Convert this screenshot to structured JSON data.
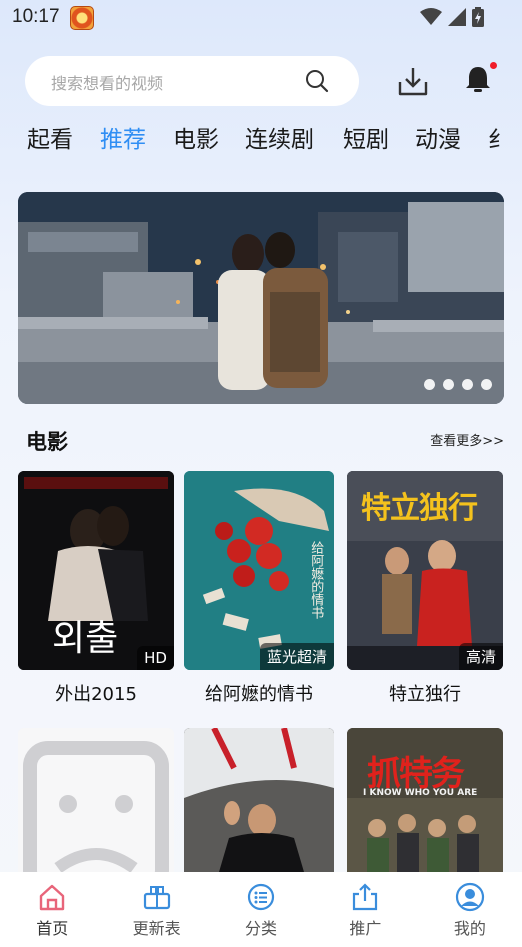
{
  "status_bar": {
    "time": "10:17"
  },
  "search": {
    "placeholder": "搜索想看的视频"
  },
  "tabs": [
    {
      "label": "起看"
    },
    {
      "label": "推荐",
      "active": true
    },
    {
      "label": "电影"
    },
    {
      "label": "连续剧"
    },
    {
      "label": "短剧"
    },
    {
      "label": "动漫"
    },
    {
      "label": "纟"
    }
  ],
  "banner": {
    "slide_count": 4
  },
  "section": {
    "title": "电影",
    "more": "查看更多>>"
  },
  "movies": [
    {
      "title": "外出2015",
      "badge": "HD",
      "poster_text": "외출"
    },
    {
      "title": "给阿嬷的情书",
      "badge": "蓝光超清",
      "poster_text": "给阿嬷的情书"
    },
    {
      "title": "特立独行",
      "badge": "高清",
      "poster_text": "特立独行"
    }
  ],
  "movies_row2": [
    {
      "poster_text": ""
    },
    {
      "poster_text": ""
    },
    {
      "poster_text": "抓特务",
      "poster_subtext": "I KNOW WHO YOU ARE"
    }
  ],
  "bottom_nav": [
    {
      "label": "首页",
      "icon": "home-icon",
      "active": true
    },
    {
      "label": "更新表",
      "icon": "schedule-icon"
    },
    {
      "label": "分类",
      "icon": "category-icon"
    },
    {
      "label": "推广",
      "icon": "share-icon"
    },
    {
      "label": "我的",
      "icon": "profile-icon"
    }
  ],
  "colors": {
    "accent": "#2f8ef4",
    "home_active": "#e8657a",
    "notification_dot": "#f01d2a"
  }
}
